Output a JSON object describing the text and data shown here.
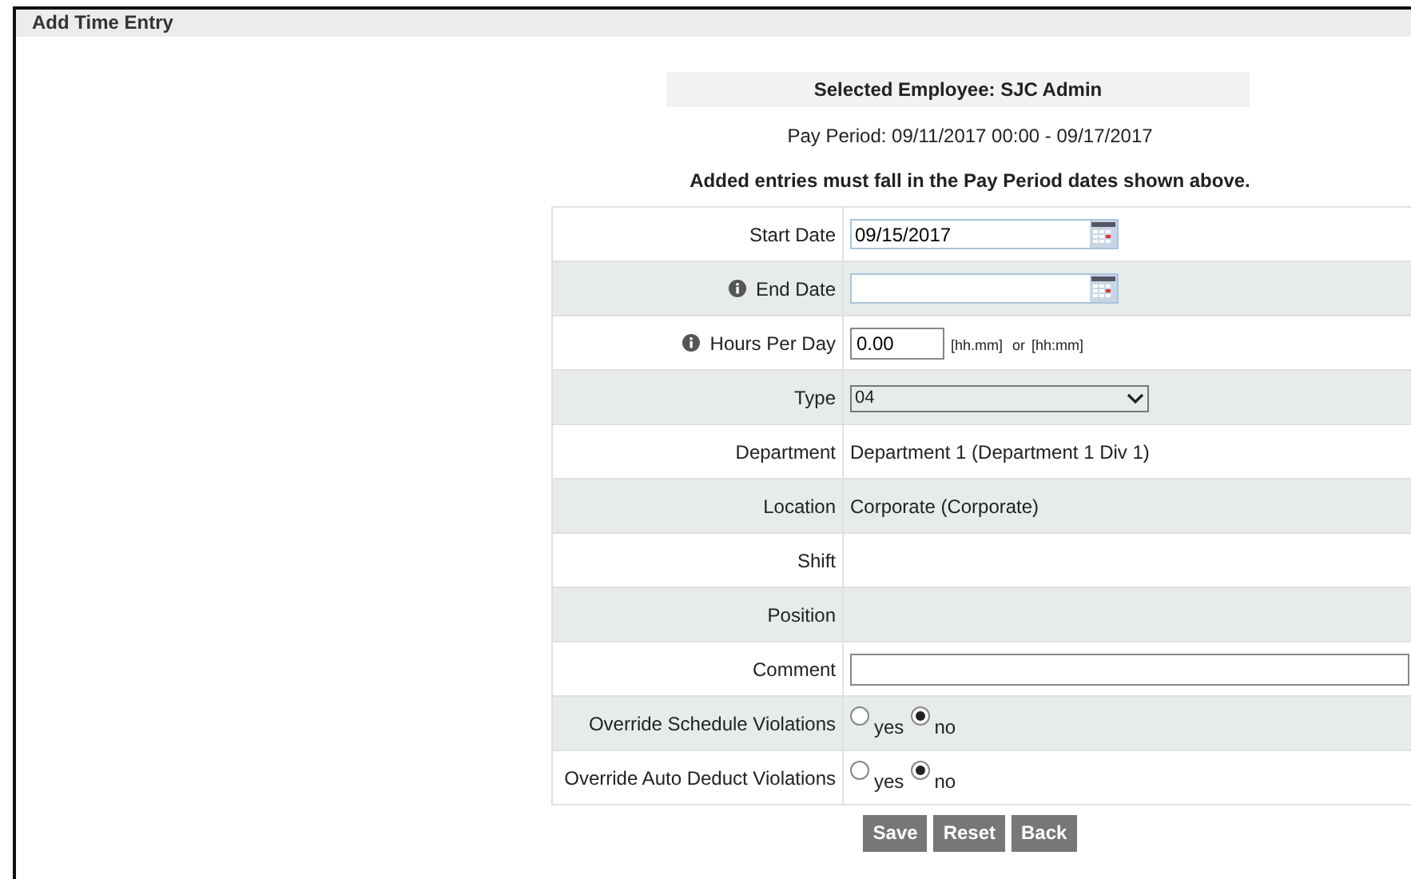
{
  "window": {
    "title": "Add Time Entry"
  },
  "employee": "Selected Employee: SJC Admin",
  "pay_period": "Pay Period: 09/11/2017 00:00 - 09/17/2017",
  "notice": "Added entries must fall in the Pay Period dates shown above.",
  "rows": [
    {
      "kind": "date",
      "label": "Start Date",
      "info": false,
      "value": "09/15/2017"
    },
    {
      "kind": "date",
      "label": "End Date",
      "info": true,
      "value": ""
    },
    {
      "kind": "hours",
      "label": "Hours Per Day",
      "info": true,
      "value": "0.00",
      "hint_1": "[hh.mm]",
      "hint_or": "or",
      "hint_2": "[hh:mm]"
    },
    {
      "kind": "select",
      "label": "Type",
      "info": false,
      "value": "04"
    },
    {
      "kind": "text",
      "label": "Department",
      "info": false,
      "value": "Department 1 (Department 1 Div 1)"
    },
    {
      "kind": "text",
      "label": "Location",
      "info": false,
      "value": "Corporate (Corporate)"
    },
    {
      "kind": "text",
      "label": "Shift",
      "info": false,
      "value": ""
    },
    {
      "kind": "text",
      "label": "Position",
      "info": false,
      "value": ""
    },
    {
      "kind": "input",
      "label": "Comment",
      "info": false,
      "value": ""
    },
    {
      "kind": "radio",
      "label": "Override Schedule Violations",
      "info": false,
      "options": [
        {
          "label": "yes",
          "selected": false
        },
        {
          "label": "no",
          "selected": true
        }
      ]
    },
    {
      "kind": "radio",
      "label": "Override Auto Deduct Violations",
      "info": false,
      "options": [
        {
          "label": "yes",
          "selected": false
        },
        {
          "label": "no",
          "selected": true
        }
      ]
    }
  ],
  "buttons": [
    "Save",
    "Reset",
    "Back"
  ]
}
